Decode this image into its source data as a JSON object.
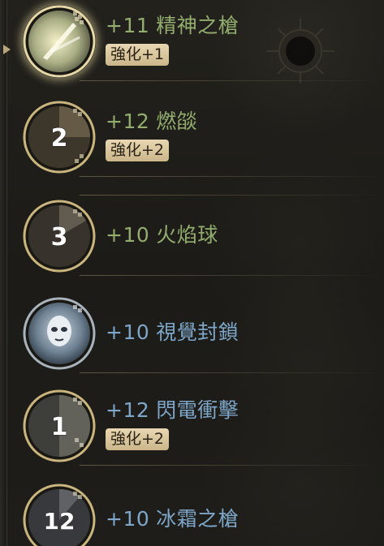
{
  "skills": [
    {
      "level": "+11",
      "name": "精神之槍",
      "enhance": "強化+1",
      "cooldown": null,
      "element": "fire",
      "selected": true,
      "icon": "spirit-spear-icon"
    },
    {
      "level": "+12",
      "name": "燃燄",
      "enhance": "強化+2",
      "cooldown": "2",
      "element": "fire",
      "selected": false,
      "icon": "flame-icon"
    },
    {
      "level": "+10",
      "name": "火焰球",
      "enhance": null,
      "cooldown": "3",
      "element": "fire",
      "selected": false,
      "icon": "fireball-icon"
    },
    {
      "level": "+10",
      "name": "視覺封鎖",
      "enhance": null,
      "cooldown": null,
      "element": "ice",
      "selected": false,
      "icon": "vision-block-icon"
    },
    {
      "level": "+12",
      "name": "閃電衝擊",
      "enhance": "強化+2",
      "cooldown": "1",
      "element": "ice",
      "selected": false,
      "icon": "lightning-strike-icon"
    },
    {
      "level": "+10",
      "name": "冰霜之槍",
      "enhance": null,
      "cooldown": "12",
      "element": "ice",
      "selected": false,
      "icon": "frost-spear-icon"
    }
  ],
  "colors": {
    "fire_text": "#93ad6e",
    "ice_text": "#7ea6c8",
    "badge_bg": "#e0ceA6",
    "ring_gold": "#d9c88f"
  }
}
